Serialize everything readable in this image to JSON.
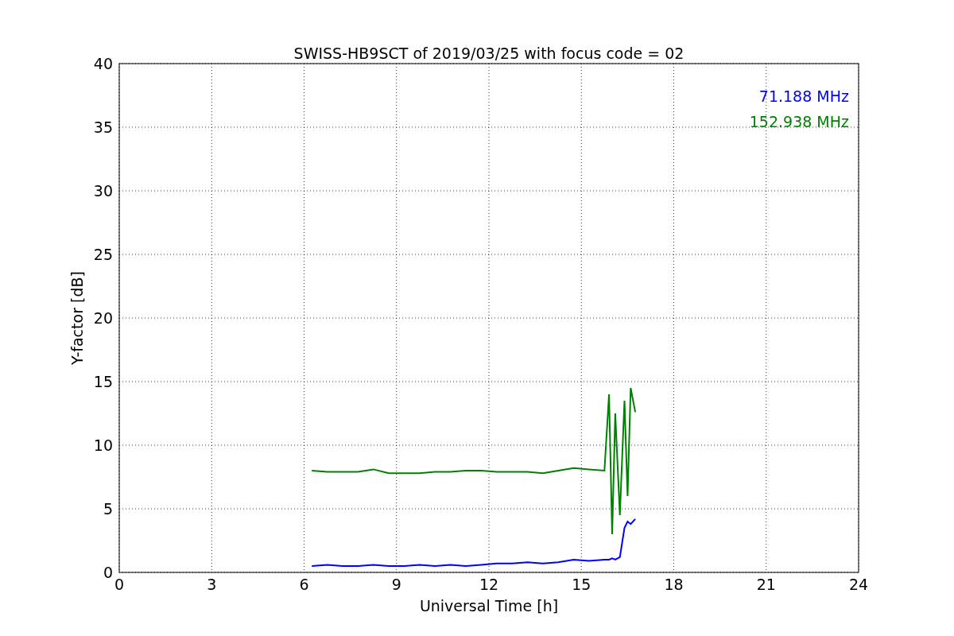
{
  "chart_data": {
    "type": "line",
    "title": "SWISS-HB9SCT of 2019/03/25 with focus code = 02",
    "xlabel": "Universal Time [h]",
    "ylabel": "Y-factor [dB]",
    "xlim": [
      0,
      24
    ],
    "ylim": [
      0,
      40
    ],
    "xticks": [
      0,
      3,
      6,
      9,
      12,
      15,
      18,
      21,
      24
    ],
    "yticks": [
      0,
      5,
      10,
      15,
      20,
      25,
      30,
      35,
      40
    ],
    "grid": true,
    "x": [
      6.25,
      6.75,
      7.25,
      7.75,
      8.25,
      8.75,
      9.25,
      9.75,
      10.25,
      10.75,
      11.25,
      11.75,
      12.25,
      12.75,
      13.25,
      13.75,
      14.25,
      14.75,
      15.25,
      15.75,
      15.9,
      16.0,
      16.1,
      16.25,
      16.4,
      16.5,
      16.6,
      16.75
    ],
    "series": [
      {
        "name": "71.188 MHz",
        "color": "#0000ff",
        "values": [
          0.5,
          0.6,
          0.5,
          0.5,
          0.6,
          0.5,
          0.5,
          0.6,
          0.5,
          0.6,
          0.5,
          0.6,
          0.7,
          0.7,
          0.8,
          0.7,
          0.8,
          1.0,
          0.9,
          1.0,
          1.0,
          1.1,
          1.0,
          1.2,
          3.5,
          4.0,
          3.8,
          4.2
        ]
      },
      {
        "name": "152.938 MHz",
        "color": "#008000",
        "values": [
          8.0,
          7.9,
          7.9,
          7.9,
          8.1,
          7.8,
          7.8,
          7.8,
          7.9,
          7.9,
          8.0,
          8.0,
          7.9,
          7.9,
          7.9,
          7.8,
          8.0,
          8.2,
          8.1,
          8.0,
          14.0,
          3.0,
          12.5,
          4.5,
          13.5,
          6.0,
          14.5,
          12.6
        ]
      }
    ]
  }
}
